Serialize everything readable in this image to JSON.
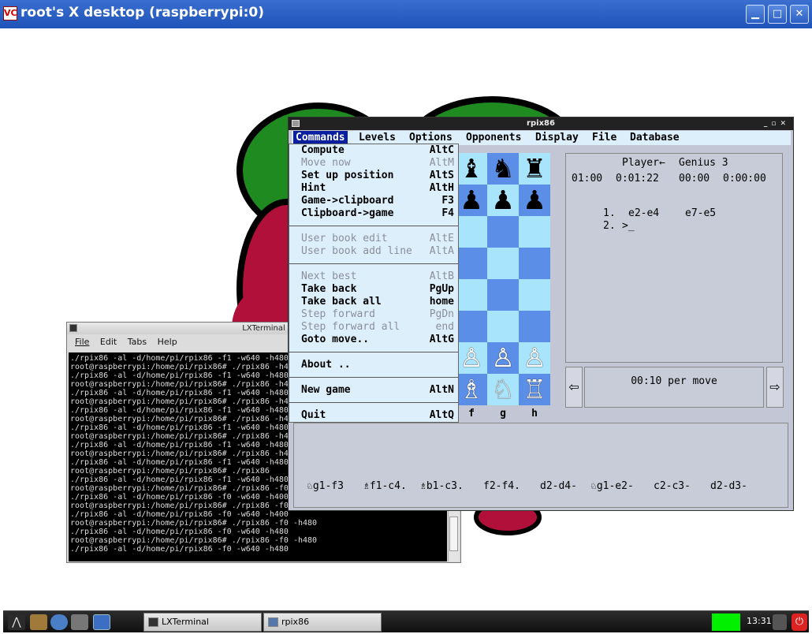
{
  "vnc": {
    "title": "root's X desktop (raspberrypi:0)",
    "logo": "VC",
    "min_icon": "minimize-icon",
    "max_icon": "maximize-icon",
    "close_icon": "close-icon"
  },
  "terminal": {
    "title": "LXTerminal",
    "menu": [
      "File",
      "Edit",
      "Tabs",
      "Help"
    ],
    "lines": [
      "./rpix86 -al -d/home/pi/rpix86 -f1 -w640 -h480",
      "root@raspberrypi:/home/pi/rpix86# ./rpix86 -h4",
      "./rpix86 -al -d/home/pi/rpix86 -f1 -w640 -h480",
      "root@raspberrypi:/home/pi/rpix86# ./rpix86 -h4",
      "./rpix86 -al -d/home/pi/rpix86 -f1 -w640 -h480",
      "root@raspberrypi:/home/pi/rpix86# ./rpix86 -h4",
      "./rpix86 -al -d/home/pi/rpix86 -f1 -w640 -h480",
      "root@raspberrypi:/home/pi/rpix86# ./rpix86 -h4",
      "./rpix86 -al -d/home/pi/rpix86 -f1 -w640 -h480",
      "root@raspberrypi:/home/pi/rpix86# ./rpix86 -h4",
      "./rpix86 -al -d/home/pi/rpix86 -f1 -w640 -h480",
      "root@raspberrypi:/home/pi/rpix86# ./rpix86 -h4",
      "./rpix86 -al -d/home/pi/rpix86 -f1 -w640 -h480",
      "root@raspberrypi:/home/pi/rpix86# ./rpix86",
      "./rpix86 -al -d/home/pi/rpix86 -f1 -w640 -h480",
      "root@raspberrypi:/home/pi/rpix86# ./rpix86 -f0",
      "./rpix86 -al -d/home/pi/rpix86 -f0 -w640 -h400",
      "root@raspberrypi:/home/pi/rpix86# ./rpix86 -f0",
      "./rpix86 -al -d/home/pi/rpix86 -f0 -w640 -h400",
      "root@raspberrypi:/home/pi/rpix86# ./rpix86 -f0 -h480",
      "./rpix86 -al -d/home/pi/rpix86 -f0 -w640 -h480",
      "root@raspberrypi:/home/pi/rpix86# ./rpix86 -f0 -h480",
      "./rpix86 -al -d/home/pi/rpix86 -f0 -w640 -h480",
      ""
    ]
  },
  "rpix": {
    "title": "rpix86",
    "menu": [
      "Commands",
      "Levels",
      "Options",
      "Opponents",
      "Display",
      "File",
      "Database"
    ],
    "dropdown": [
      {
        "label": "Compute",
        "key": "AltC",
        "disabled": false
      },
      {
        "label": "Move now",
        "key": "AltM",
        "disabled": true
      },
      {
        "label": "Set up position",
        "key": "AltS",
        "disabled": false
      },
      {
        "label": "Hint",
        "key": "AltH",
        "disabled": false
      },
      {
        "label": "Game->clipboard",
        "key": "F3",
        "disabled": false
      },
      {
        "label": "Clipboard->game",
        "key": "F4",
        "disabled": false
      },
      {
        "label": "User book edit",
        "key": "AltE",
        "disabled": true
      },
      {
        "label": "User book add line",
        "key": "AltA",
        "disabled": true
      },
      {
        "label": "Next best",
        "key": "AltB",
        "disabled": true
      },
      {
        "label": "Take back",
        "key": "PgUp",
        "disabled": false
      },
      {
        "label": "Take back all",
        "key": "home",
        "disabled": false
      },
      {
        "label": "Step forward",
        "key": "PgDn",
        "disabled": true
      },
      {
        "label": "Step forward all",
        "key": "end",
        "disabled": true
      },
      {
        "label": "Goto move..",
        "key": "AltG",
        "disabled": false
      },
      {
        "label": "About ..",
        "key": "",
        "disabled": false
      },
      {
        "label": "New game",
        "key": "AltN",
        "disabled": false
      },
      {
        "label": "Quit",
        "key": "AltQ",
        "disabled": false
      }
    ],
    "files": [
      "f",
      "g",
      "h"
    ],
    "pieces": {
      "black_bishop": "♝",
      "black_knight": "♞",
      "black_rook": "♜",
      "black_pawn": "♟",
      "white_pawn": "♙",
      "white_bishop": "♗",
      "white_knight": "♘",
      "white_rook": "♖"
    },
    "players": {
      "white": "Player←",
      "black": "Genius 3"
    },
    "clocks": [
      "01:00",
      "0:01:22",
      "00:00",
      "0:00:00"
    ],
    "moves": [
      {
        "num": "1.",
        "white": "e2-e4",
        "black": "e7-e5"
      },
      {
        "num": "2.",
        "white": ">_",
        "black": ""
      }
    ],
    "per_move": "00:10 per move",
    "suggestions": [
      "♘g1-f3",
      "♗f1-c4.",
      "♗b1-c3.",
      "f2-f4.",
      "d2-d4-",
      "♘g1-e2-",
      "c2-c3-",
      "d2-d3-"
    ]
  },
  "taskbar": {
    "tasks": [
      "LXTerminal",
      "rpix86"
    ],
    "clock": "13:31"
  }
}
